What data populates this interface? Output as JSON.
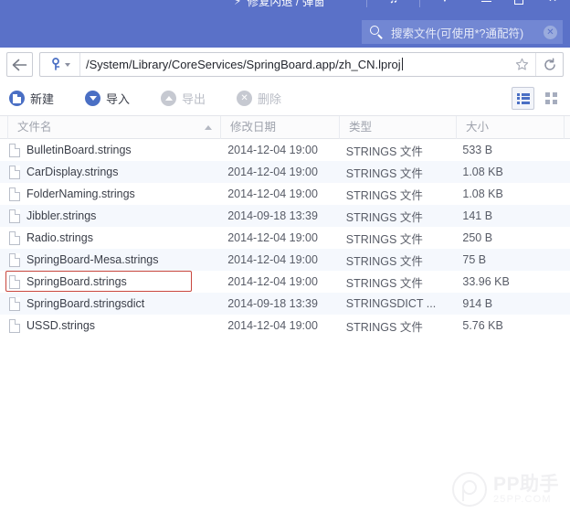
{
  "titlebar": {
    "promo_text": "修复闪退 / 弹窗",
    "bolt_icon": "lightning-bolt-icon",
    "music_icon": "music-note-icon",
    "chevron_label": "▼",
    "minimize_label": "",
    "maximize_label": "",
    "close_label": "✕",
    "background_color": "#5a71c8"
  },
  "search": {
    "placeholder": "搜索文件(可使用*?通配符)",
    "value": "",
    "clear_label": "✕",
    "icon": "search-icon"
  },
  "address": {
    "back_label": "",
    "device_icon": "key-icon",
    "path": "/System/Library/CoreServices/SpringBoard.app/zh_CN.lproj",
    "star_label": "☆",
    "reload_label": "⟳"
  },
  "toolbar": {
    "items": [
      {
        "label": "新建",
        "icon": "new-file-icon",
        "disabled": false
      },
      {
        "label": "导入",
        "icon": "import-down-arrow-icon",
        "disabled": false
      },
      {
        "label": "导出",
        "icon": "export-up-arrow-icon",
        "disabled": true
      },
      {
        "label": "删除",
        "icon": "delete-x-icon",
        "disabled": true
      }
    ],
    "view_list_label": "list-view",
    "view_grid_label": "grid-view",
    "active_view": "list"
  },
  "columns": {
    "name": "文件名",
    "date": "修改日期",
    "type": "类型",
    "size": "大小",
    "sort_column": "name",
    "sort_direction": "asc"
  },
  "files": [
    {
      "name": "BulletinBoard.strings",
      "date": "2014-12-04 19:00",
      "type": "STRINGS 文件",
      "size": "533 B",
      "highlighted": false
    },
    {
      "name": "CarDisplay.strings",
      "date": "2014-12-04 19:00",
      "type": "STRINGS 文件",
      "size": "1.08 KB",
      "highlighted": false
    },
    {
      "name": "FolderNaming.strings",
      "date": "2014-12-04 19:00",
      "type": "STRINGS 文件",
      "size": "1.08 KB",
      "highlighted": false
    },
    {
      "name": "Jibbler.strings",
      "date": "2014-09-18 13:39",
      "type": "STRINGS 文件",
      "size": "141 B",
      "highlighted": false
    },
    {
      "name": "Radio.strings",
      "date": "2014-12-04 19:00",
      "type": "STRINGS 文件",
      "size": "250 B",
      "highlighted": false
    },
    {
      "name": "SpringBoard-Mesa.strings",
      "date": "2014-12-04 19:00",
      "type": "STRINGS 文件",
      "size": "75 B",
      "highlighted": false
    },
    {
      "name": "SpringBoard.strings",
      "date": "2014-12-04 19:00",
      "type": "STRINGS 文件",
      "size": "33.96 KB",
      "highlighted": true
    },
    {
      "name": "SpringBoard.stringsdict",
      "date": "2014-09-18 13:39",
      "type": "STRINGSDICT ...",
      "size": "914 B",
      "highlighted": false
    },
    {
      "name": "USSD.strings",
      "date": "2014-12-04 19:00",
      "type": "STRINGS 文件",
      "size": "5.76 KB",
      "highlighted": false
    }
  ],
  "watermark": {
    "main": "PP助手",
    "sub": "25PP.COM"
  },
  "colors": {
    "titlebar": "#5a71c8",
    "accent": "#4a6fc4",
    "row_alt": "#f5f8fd",
    "highlight_border": "#c8473e"
  }
}
